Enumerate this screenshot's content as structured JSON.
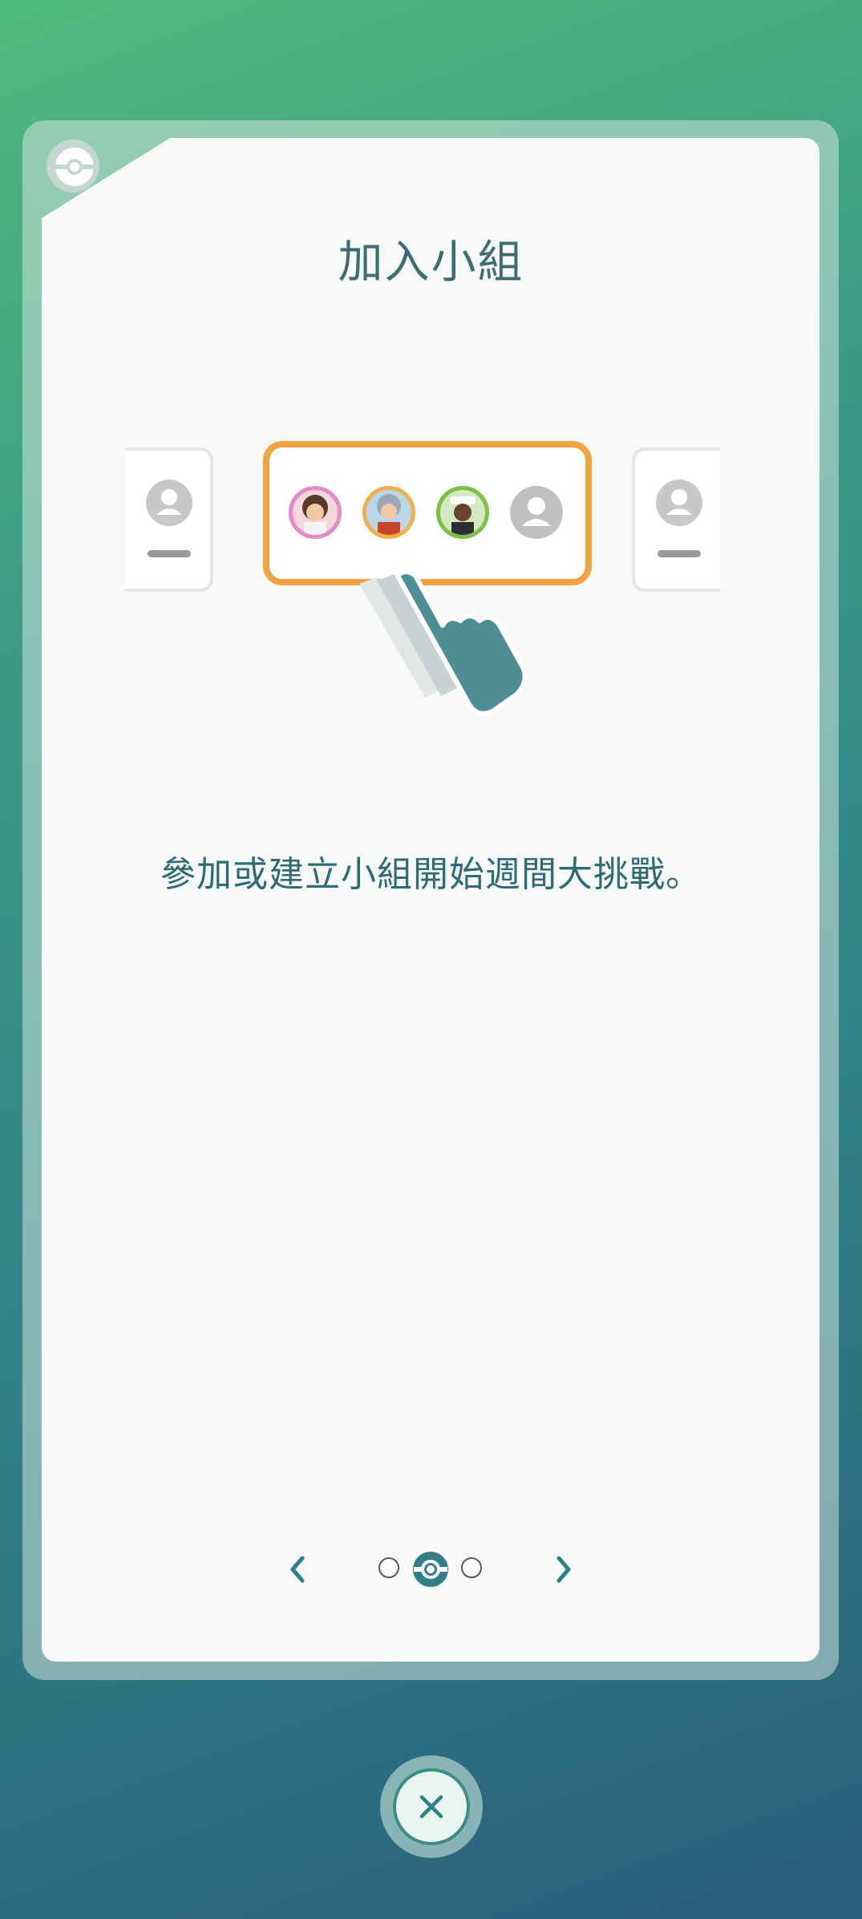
{
  "dialog": {
    "title": "加入小組",
    "description": "參加或建立小組開始週間大挑戰。"
  },
  "pager": {
    "pages": 3,
    "current_page": 2,
    "prev_icon": "chevron-left-icon",
    "next_icon": "chevron-right-icon"
  },
  "close_button": {
    "icon": "close-icon"
  },
  "colors": {
    "accent": "#2f7f86",
    "group_highlight": "#f2a340",
    "text": "#2f6b76"
  }
}
